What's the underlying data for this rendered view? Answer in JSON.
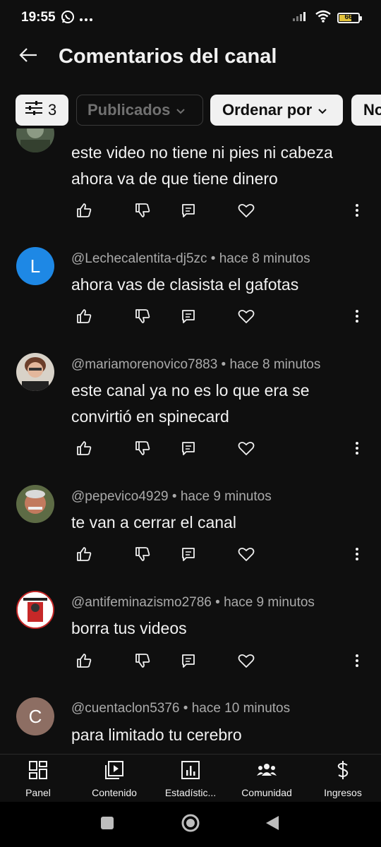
{
  "status_bar": {
    "time": "19:55",
    "battery_level": "66",
    "battery_fraction": 0.66,
    "battery_color": "#e3c33b",
    "icons": [
      "whatsapp-icon",
      "more-dots-icon",
      "signal-icon",
      "wifi-icon",
      "battery-icon"
    ]
  },
  "header": {
    "title": "Comentarios del canal",
    "back_icon": "arrow-left-icon"
  },
  "filters": {
    "filter_count": "3",
    "published_label": "Publicados",
    "order_label": "Ordenar por",
    "more_label": "No"
  },
  "comments": [
    {
      "author": "",
      "time": "",
      "text": "este video no tiene ni pies ni cabeza ahora va de que tiene dinero",
      "avatar_letter": "",
      "avatar_color": "#5a6b55"
    },
    {
      "author": "@Lechecalentita-dj5zc",
      "time": "hace 8 minutos",
      "text": "ahora vas de clasista el gafotas",
      "avatar_letter": "L",
      "avatar_color": "#1e88e5"
    },
    {
      "author": "@mariamorenovico7883",
      "time": "hace 8 minutos",
      "text": "este canal ya no es lo que era se convirtió en spinecard",
      "avatar_letter": "",
      "avatar_color": "#8a6f5e"
    },
    {
      "author": "@pepevico4929",
      "time": "hace 9 minutos",
      "text": "te van a cerrar el canal",
      "avatar_letter": "",
      "avatar_color": "#6e7a54"
    },
    {
      "author": "@antifeminazismo2786",
      "time": "hace 9 minutos",
      "text": "borra tus videos",
      "avatar_letter": "",
      "avatar_color": "#ffffff"
    },
    {
      "author": "@cuentaclon5376",
      "time": "hace 10 minutos",
      "text": "para limitado tu cerebro",
      "avatar_letter": "C",
      "avatar_color": "#8d6e63"
    }
  ],
  "bottom_nav": [
    {
      "label": "Panel",
      "icon": "dashboard-icon"
    },
    {
      "label": "Contenido",
      "icon": "content-icon"
    },
    {
      "label": "Estadístic...",
      "icon": "analytics-icon"
    },
    {
      "label": "Comunidad",
      "icon": "community-icon"
    },
    {
      "label": "Ingresos",
      "icon": "dollar-icon"
    }
  ]
}
